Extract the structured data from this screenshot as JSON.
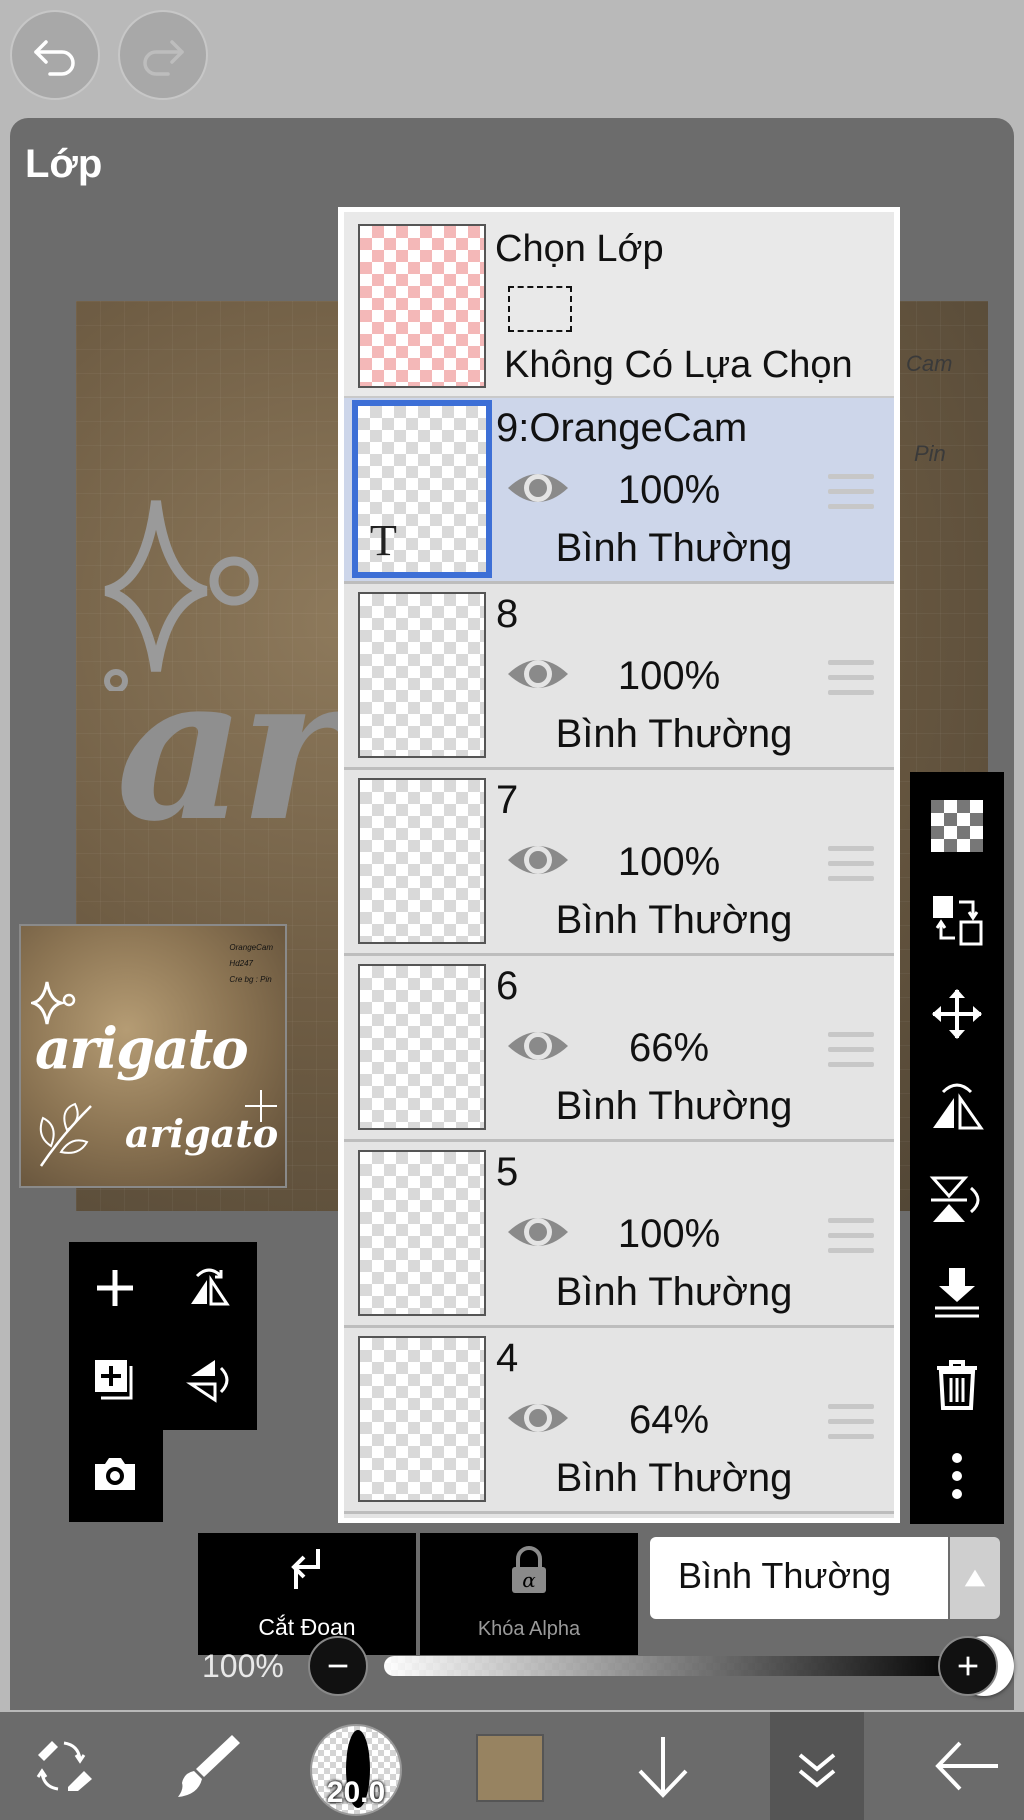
{
  "panel": {
    "title": "Lớp"
  },
  "canvas": {
    "script_text": "ar",
    "side_text_1": "Cam",
    "side_text_2": "Pin"
  },
  "preview": {
    "big_word": "arigato",
    "small_word": "arigato",
    "meta_line1": "OrangeCam",
    "meta_line2": "Hd247",
    "meta_line3": "Cre bg : Pin"
  },
  "selection_row": {
    "title": "Chọn Lớp",
    "status": "Không Có Lựa Chọn"
  },
  "layers": [
    {
      "name": "9:OrangeCam",
      "opacity": "100%",
      "blend": "Bình Thường",
      "active": true,
      "type": "text"
    },
    {
      "name": "8",
      "opacity": "100%",
      "blend": "Bình Thường",
      "active": false,
      "type": "image"
    },
    {
      "name": "7",
      "opacity": "100%",
      "blend": "Bình Thường",
      "active": false,
      "type": "image"
    },
    {
      "name": "6",
      "opacity": "66%",
      "blend": "Bình Thường",
      "active": false,
      "type": "image"
    },
    {
      "name": "5",
      "opacity": "100%",
      "blend": "Bình Thường",
      "active": false,
      "type": "image"
    },
    {
      "name": "4",
      "opacity": "64%",
      "blend": "Bình Thường",
      "active": false,
      "type": "image"
    }
  ],
  "bottom_controls": {
    "clip_label": "Cắt Đoạn",
    "alpha_lock_label": "Khóa Alpha",
    "blend_mode_value": "Bình Thường"
  },
  "opacity_slider": {
    "label": "100%",
    "value": 1.0
  },
  "toolbar": {
    "brush_size": "20.0",
    "color": "#978361"
  },
  "colors": {
    "panel_bg": "#6c6c6c",
    "active_layer_bg": "#cdd6ea",
    "active_border": "#3d6fd6"
  }
}
